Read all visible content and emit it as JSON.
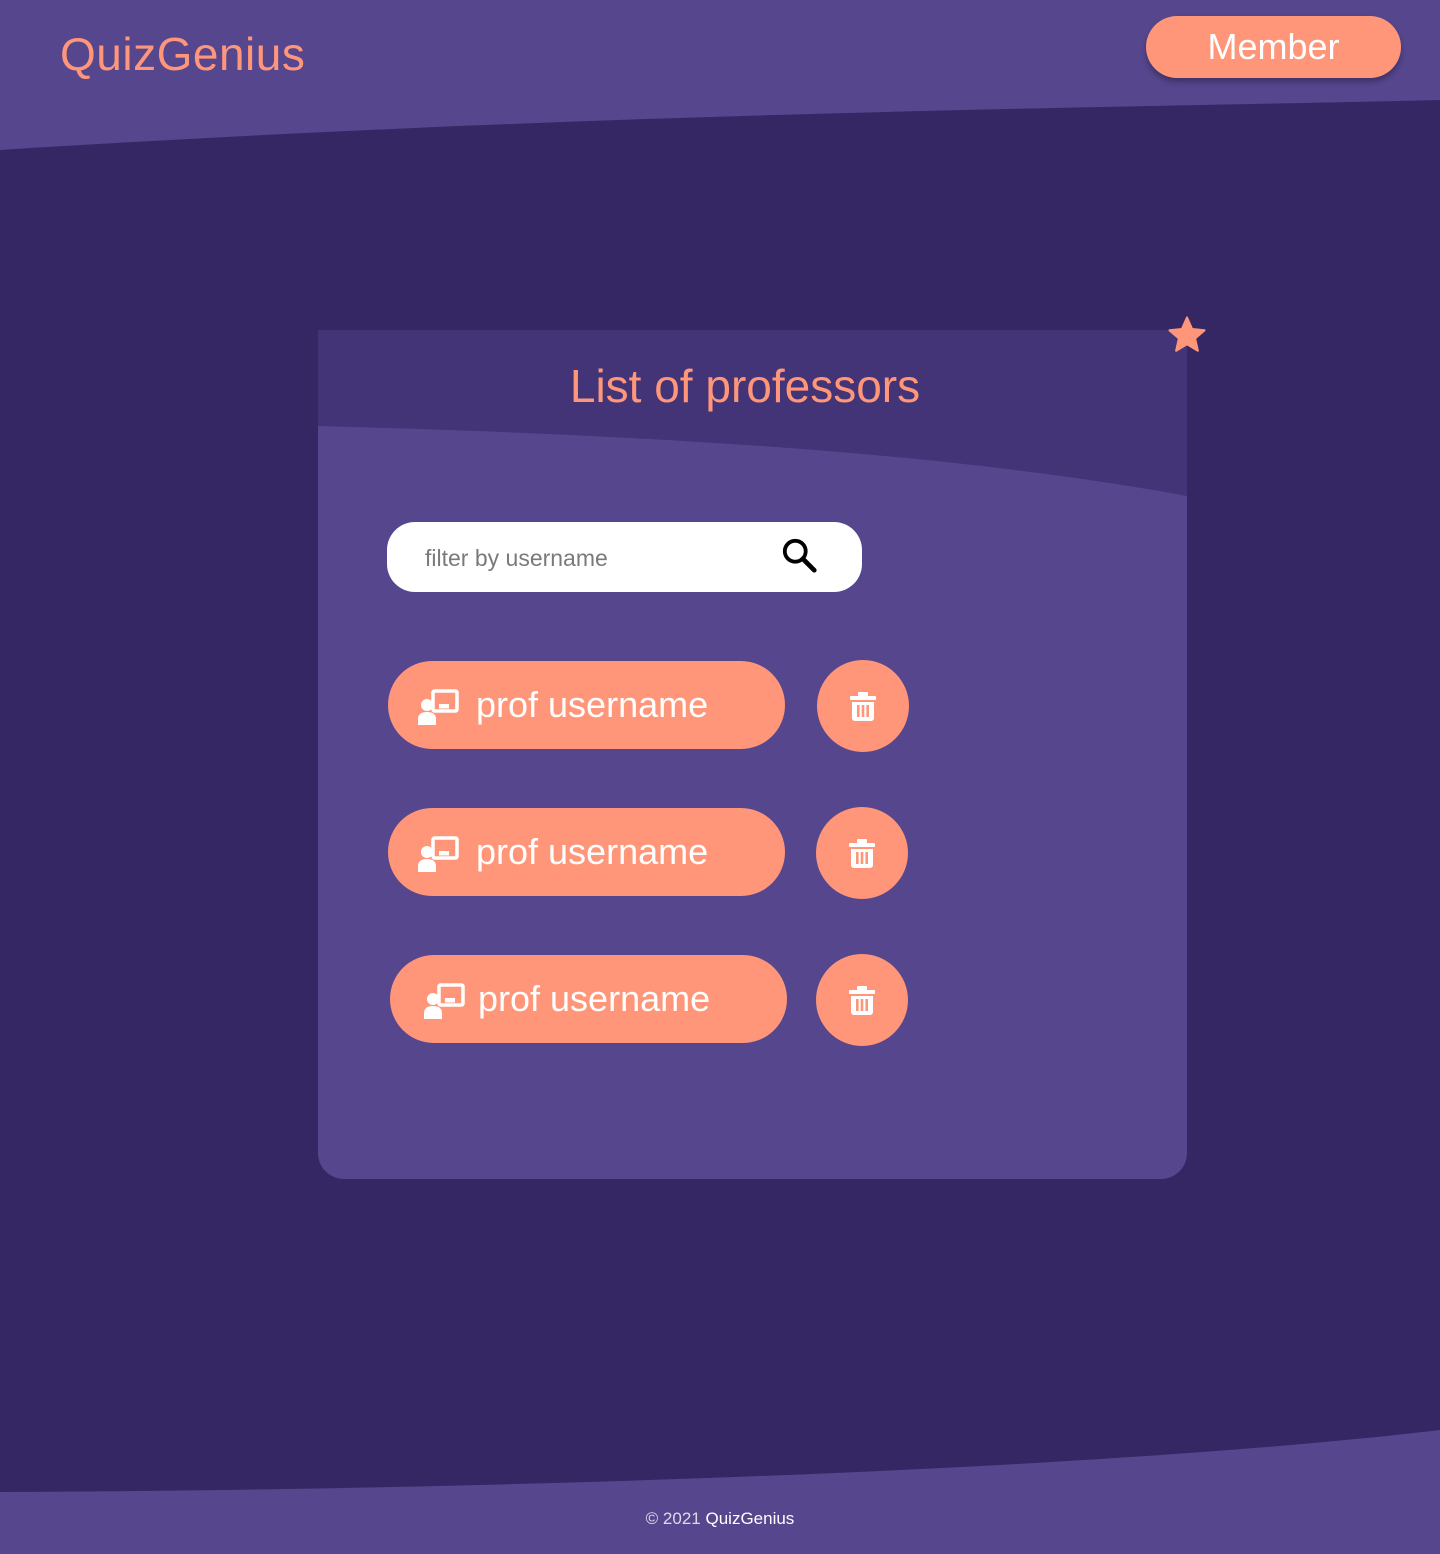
{
  "header": {
    "brand": "QuizGenius",
    "member_label": "Member"
  },
  "card": {
    "title": "List of professors"
  },
  "search": {
    "placeholder": "filter by username",
    "value": ""
  },
  "professors": [
    {
      "label": "prof username"
    },
    {
      "label": "prof username"
    },
    {
      "label": "prof username"
    }
  ],
  "footer": {
    "copyright": "© 2021",
    "brand": "QuizGenius"
  },
  "icons": {
    "search": "search-icon",
    "star": "star-icon",
    "professor": "teacher-icon",
    "delete": "trash-icon"
  },
  "colors": {
    "background_dark": "#352763",
    "panel_purple": "#55468E",
    "card_header": "#423477",
    "accent_salmon": "#FF967A",
    "text_white": "#FFFFFF"
  }
}
